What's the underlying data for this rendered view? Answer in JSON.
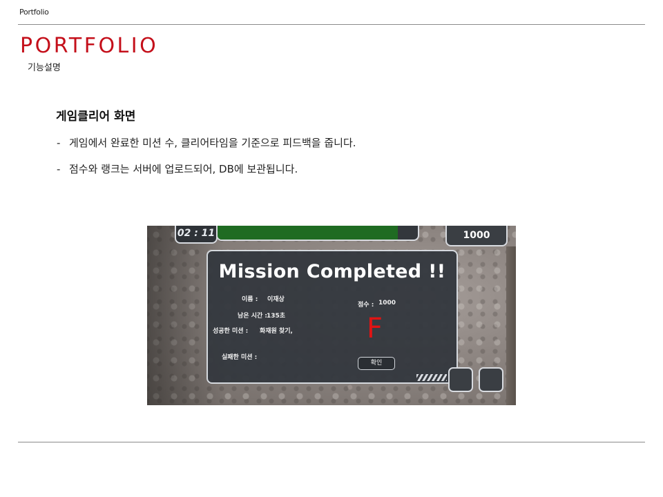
{
  "header": {
    "small_title": "Portfolio",
    "big_title": "PORTFOLIO",
    "sub_title": "기능설명"
  },
  "section": {
    "heading": "게임클리어 화면",
    "bullets": [
      {
        "dash": "-",
        "text": "게임에서 완료한 미션 수, 클리어타임을 기준으로 피드백을 줍니다."
      },
      {
        "dash": "-",
        "text": "점수와 랭크는 서버에 업로드되어, DB에 보관됩니다."
      }
    ]
  },
  "game": {
    "timer": "02 : 11",
    "progress": 0.9,
    "score_top": "1000",
    "title": "Mission Completed !!",
    "name_label": "이름 :",
    "name_value": "이재상",
    "time_label": "남은 시간 :",
    "time_value": "135초",
    "success_label": "성공한 미션 :",
    "success_value": "화재원 찾기,",
    "fail_label": "실패한 미션 :",
    "score_label": "점수 :",
    "score_value": "1000",
    "grade": "F",
    "confirm": "확인",
    "colors": {
      "grade": "#e01414",
      "progress": "#1f6b22",
      "accent": "#c40f1a"
    }
  }
}
